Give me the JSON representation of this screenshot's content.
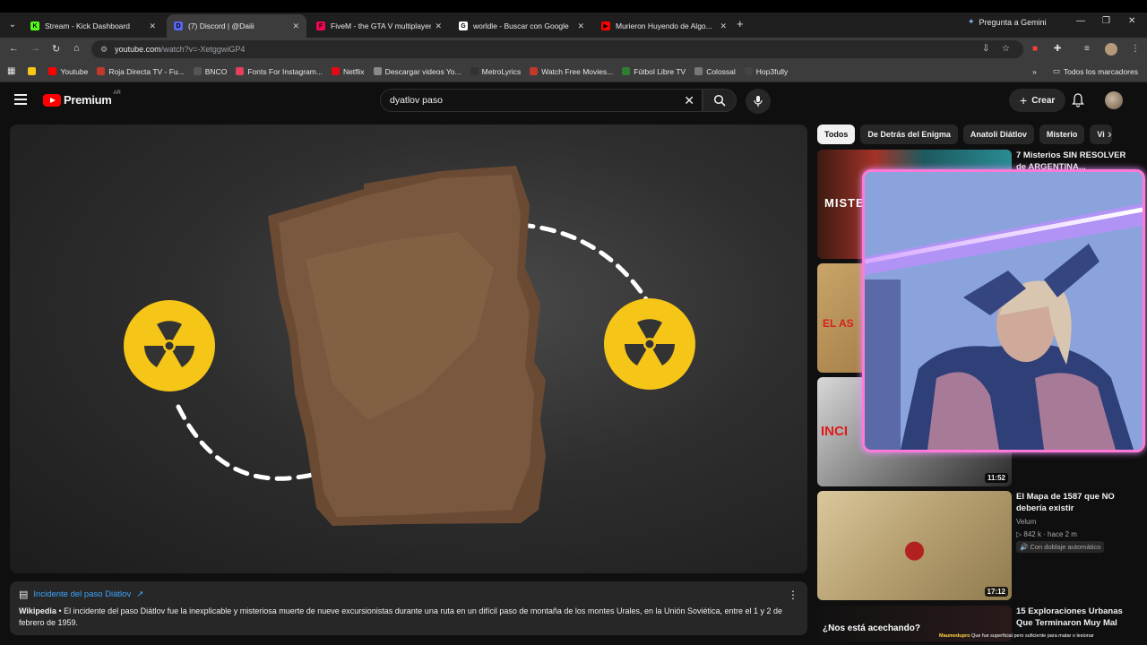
{
  "tabs": [
    {
      "label": "Stream - Kick Dashboard",
      "fav": "K",
      "color": "#53fc18",
      "active": false
    },
    {
      "label": "(7) Discord | @Daiii",
      "fav": "D",
      "color": "#5865f2",
      "active": true
    },
    {
      "label": "FiveM - the GTA V multiplayer",
      "fav": "F",
      "color": "#f40552",
      "active": false
    },
    {
      "label": "worldle - Buscar con Google",
      "fav": "G",
      "color": "#ffffff",
      "active": false
    },
    {
      "label": "Murieron Huyendo de Algo...",
      "fav": "▶",
      "color": "#ff0000",
      "active": false
    }
  ],
  "browser": {
    "gemini_label": "Pregunta a Gemini",
    "url_domain": "youtube.com",
    "url_path": "/watch?v=-XetggwiGP4"
  },
  "bookmarks": [
    {
      "label": "",
      "color": "#f5c518"
    },
    {
      "label": "Youtube",
      "color": "#ff0000"
    },
    {
      "label": "Roja Directa TV - Fu...",
      "color": "#c0392b"
    },
    {
      "label": "BNCO",
      "color": "#555555"
    },
    {
      "label": "Fonts For Instagram...",
      "color": "#e4405f"
    },
    {
      "label": "Netflix",
      "color": "#e50914"
    },
    {
      "label": "Descargar videos Yo...",
      "color": "#888888"
    },
    {
      "label": "MetroLyrics",
      "color": "#333333"
    },
    {
      "label": "Watch Free Movies...",
      "color": "#c0392b"
    },
    {
      "label": "Fútbol Libre TV",
      "color": "#2e7d32"
    },
    {
      "label": "Colossal",
      "color": "#777777"
    },
    {
      "label": "Hop3fully",
      "color": "#444444"
    }
  ],
  "bookmarks_all": "Todos los marcadores",
  "youtube": {
    "logo_word": "Premium",
    "country": "AR",
    "search_query": "dyatlov paso",
    "create_label": "Crear"
  },
  "wiki": {
    "title": "Incidente del paso Diátlov",
    "source": "Wikipedia",
    "text": " • El incidente del paso Diátlov fue la inexplicable y misteriosa muerte de nueve excursionistas durante una ruta en un difícil paso de montaña de los montes Urales, en la Unión Soviética, entre el 1 y 2 de febrero de 1959."
  },
  "chips": [
    "Todos",
    "De Detrás del Enigma",
    "Anatoli Diátlov",
    "Misterio",
    "Vi"
  ],
  "recommendations": [
    {
      "title": "7 Misterios SIN RESOLVER de ARGENTINA...",
      "channel": "",
      "meta": "",
      "badge": "",
      "duration": ""
    },
    {
      "title": "",
      "channel": "",
      "meta": "",
      "badge": "",
      "duration": ""
    },
    {
      "title": "",
      "channel": "",
      "meta": "",
      "badge": "",
      "duration": "11:52"
    },
    {
      "title": "El Mapa de 1587 que NO debería existir",
      "channel": "Velum",
      "meta": "842 k · hace 2 m",
      "badge": "Con doblaje automático",
      "duration": "17:12"
    },
    {
      "title": "15 Exploraciones Urbanas Que Terminaron Muy Mal",
      "channel": "",
      "meta": "",
      "badge": "",
      "duration": ""
    }
  ],
  "thumb_text": {
    "misterios": "MISTE",
    "asesino": "EL AS",
    "incidente": "INCI",
    "acechando": "¿Nos está acechando?"
  },
  "ticker": {
    "user": "Maumedupro",
    "text": " Que fue superficial pero suficiente para matar o lesionar"
  },
  "colors": {
    "accent": "#3ea6ff",
    "brand": "#ff0000",
    "radiation": "#f5c518"
  }
}
